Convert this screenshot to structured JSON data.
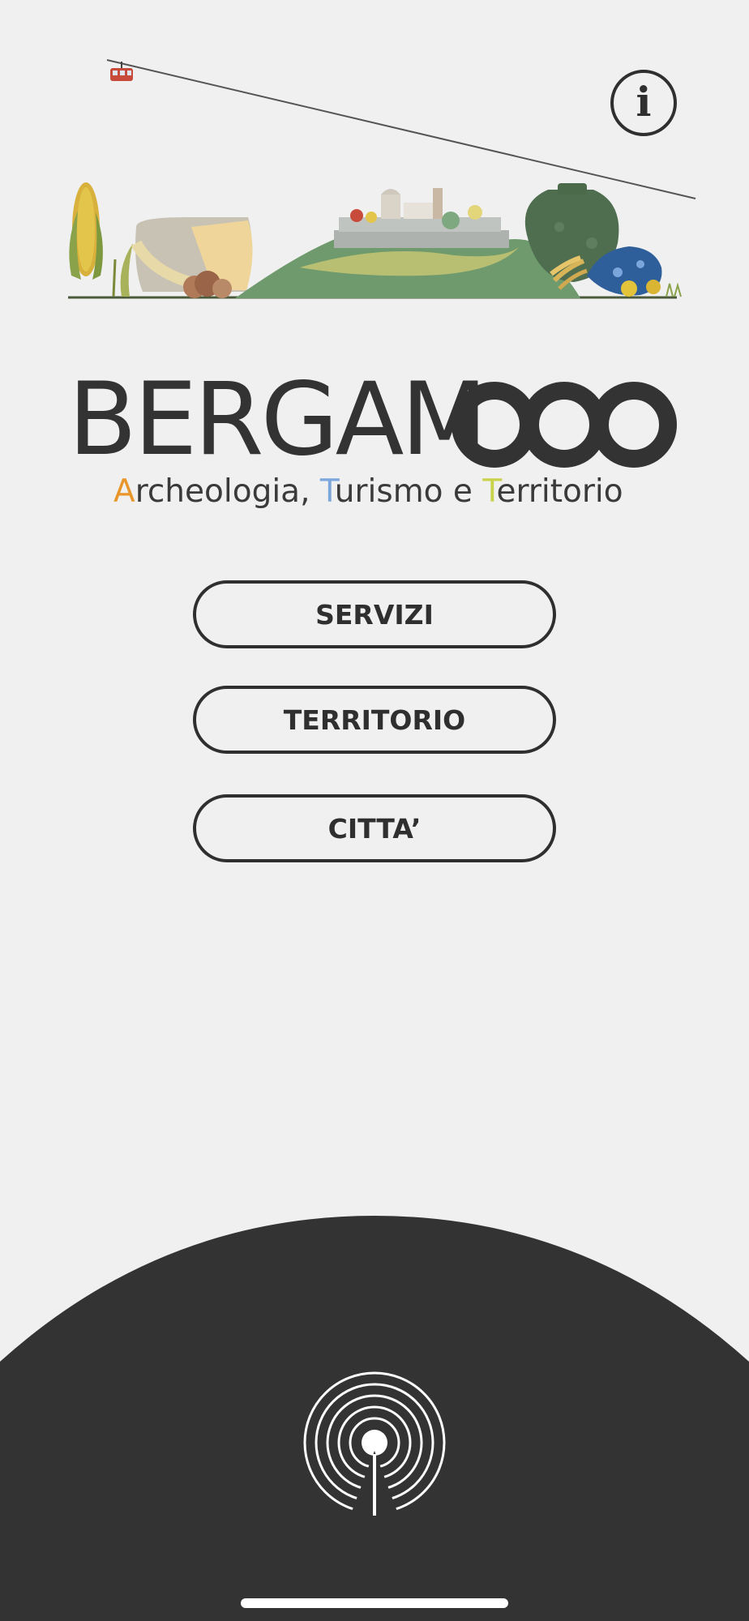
{
  "app": {
    "logo_text": "BERGAM",
    "tagline": {
      "part1_initial": "A",
      "part1_rest": "rcheologia, ",
      "part2_initial": "T",
      "part2_rest": "urismo e ",
      "part3_initial": "T",
      "part3_rest": "erritorio"
    }
  },
  "header": {
    "info_label": "i"
  },
  "menu": {
    "items": [
      {
        "label": "SERVIZI"
      },
      {
        "label": "TERRITORIO"
      },
      {
        "label": "CITTA’"
      }
    ]
  },
  "colors": {
    "background": "#f0f0f0",
    "dark": "#333333",
    "accent_orange": "#e8962a",
    "accent_blue": "#7ba6dc",
    "accent_yellow": "#c8d24a"
  },
  "icons": {
    "info": "info-icon",
    "nfc": "nfc-icon",
    "cable_car": "cable-car-icon"
  }
}
